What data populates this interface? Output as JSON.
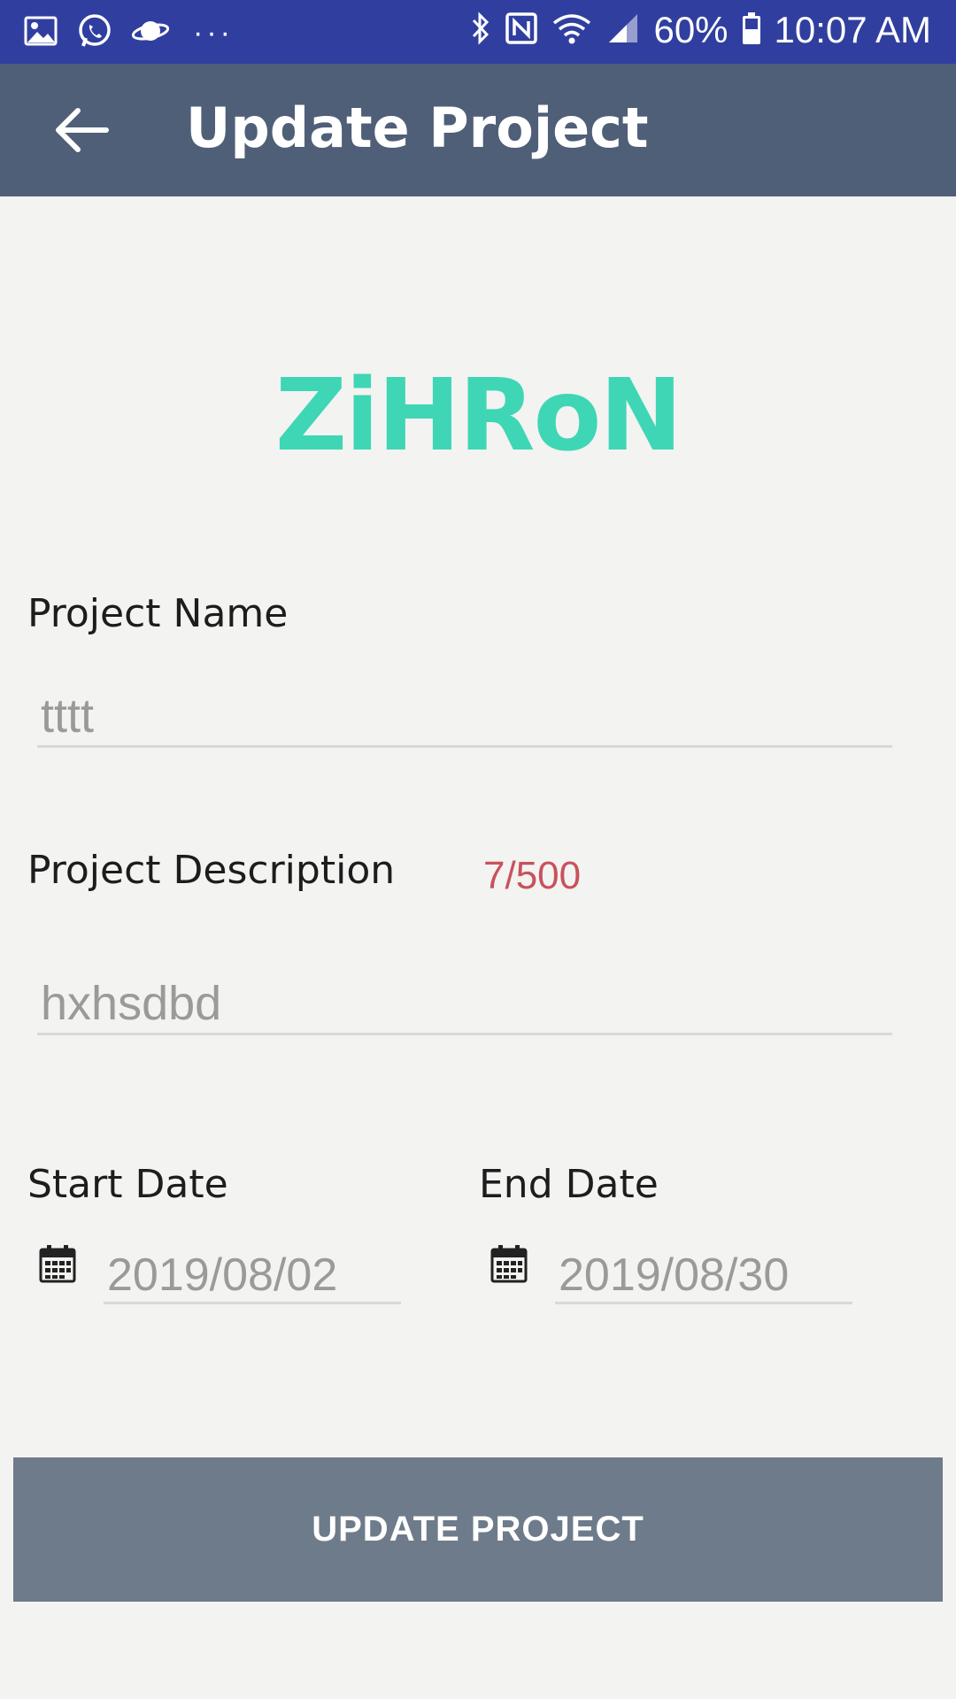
{
  "status_bar": {
    "battery": "60%",
    "time": "10:07 AM",
    "icons": [
      "gallery-icon",
      "whatsapp-icon",
      "planet-icon",
      "more-icon",
      "bluetooth-icon",
      "nfc-icon",
      "wifi-icon",
      "signal-icon",
      "battery-icon"
    ]
  },
  "app_bar": {
    "title": "Update Project",
    "back_icon": "arrow-left-icon"
  },
  "logo": {
    "text": "ZiHRoN",
    "color": "#3fd6b5"
  },
  "form": {
    "project_name_label": "Project Name",
    "project_name_value": "tttt",
    "project_description_label": "Project Description",
    "description_counter": "7/500",
    "project_description_value": "hxhsdbd",
    "start_date_label": "Start Date",
    "start_date_value": "2019/08/02",
    "end_date_label": "End Date",
    "end_date_value": "2019/08/30"
  },
  "actions": {
    "update_label": "UPDATE  PROJECT"
  },
  "colors": {
    "status_bar": "#303f9f",
    "app_bar": "#4f5f78",
    "accent": "#3fd6b5",
    "counter": "#c8525c",
    "button": "#6e7b8b",
    "background": "#f3f3f1"
  }
}
